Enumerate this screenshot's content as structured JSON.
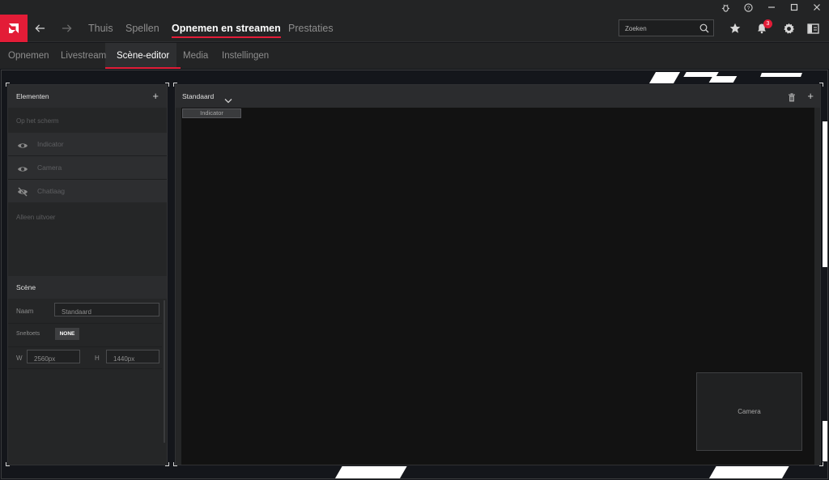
{
  "titlebar": {
    "bug_icon": "bug-icon",
    "help_icon": "help-icon",
    "minimize_icon": "minimize-icon",
    "maximize_icon": "maximize-icon",
    "close_icon": "close-icon"
  },
  "brand": {
    "accent": "#e31c37",
    "logo_icon": "amd-logo-icon"
  },
  "mainnav": {
    "items": [
      {
        "label": "Thuis",
        "active": false
      },
      {
        "label": "Spellen",
        "active": false
      },
      {
        "label": "Opnemen en streamen",
        "active": true
      },
      {
        "label": "Prestaties",
        "active": false
      }
    ],
    "search_placeholder": "Zoeken",
    "notification_count": "3"
  },
  "subnav": {
    "items": [
      {
        "label": "Opnemen",
        "active": false
      },
      {
        "label": "Livestream",
        "active": false
      },
      {
        "label": "Scène-editor",
        "active": true
      },
      {
        "label": "Media",
        "active": false
      },
      {
        "label": "Instellingen",
        "active": false
      }
    ]
  },
  "elements_panel": {
    "title": "Elementen",
    "add_label": "+",
    "section_on_screen": "Op het scherm",
    "items": [
      {
        "label": "Indicator",
        "icon": "eye-icon"
      },
      {
        "label": "Camera",
        "icon": "eye-icon"
      },
      {
        "label": "Chatlaag",
        "icon": "eye-off-icon"
      }
    ],
    "section_output_only": "Alleen uitvoer"
  },
  "scene_panel": {
    "title": "Scène",
    "name_label": "Naam",
    "name_value": "Standaard",
    "hotkey_label": "Sneltoets",
    "hotkey_value": "NONE",
    "width_label": "W",
    "width_value": "2560px",
    "height_label": "H",
    "height_value": "1440px"
  },
  "editor": {
    "scene_select": "Standaard",
    "add_label": "+",
    "canvas_elements": {
      "indicator": "Indicator",
      "camera": "Camera"
    }
  }
}
